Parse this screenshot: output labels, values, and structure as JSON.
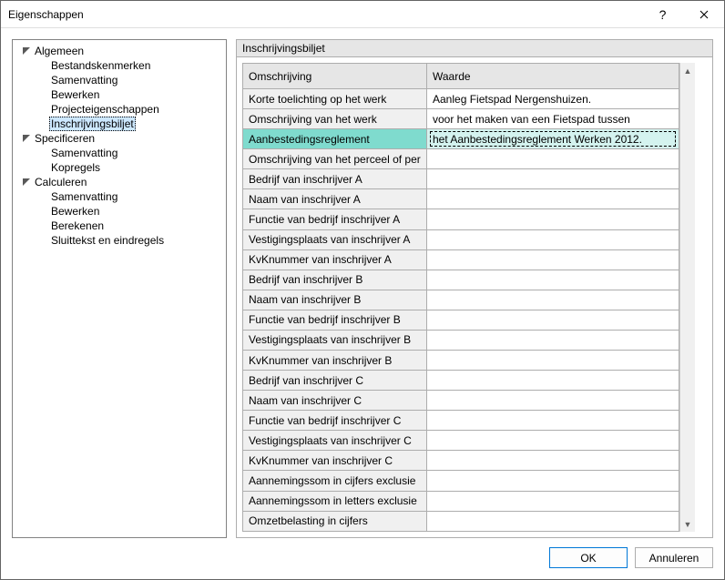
{
  "dialog": {
    "title": "Eigenschappen"
  },
  "buttons": {
    "ok": "OK",
    "cancel": "Annuleren"
  },
  "tree": {
    "groups": [
      {
        "label": "Algemeen",
        "items": [
          {
            "label": "Bestandskenmerken"
          },
          {
            "label": "Samenvatting"
          },
          {
            "label": "Bewerken"
          },
          {
            "label": "Projecteigenschappen"
          },
          {
            "label": "Inschrijvingsbiljet",
            "selected": true
          }
        ]
      },
      {
        "label": "Specificeren",
        "items": [
          {
            "label": "Samenvatting"
          },
          {
            "label": "Kopregels"
          }
        ]
      },
      {
        "label": "Calculeren",
        "items": [
          {
            "label": "Samenvatting"
          },
          {
            "label": "Bewerken"
          },
          {
            "label": "Berekenen"
          },
          {
            "label": "Sluittekst en eindregels"
          }
        ]
      }
    ]
  },
  "panel": {
    "title": "Inschrijvingsbiljet",
    "columns": {
      "desc": "Omschrijving",
      "val": "Waarde"
    },
    "rows": [
      {
        "desc": "Korte toelichting op het werk",
        "val": "Aanleg Fietspad Nergenshuizen."
      },
      {
        "desc": "Omschrijving van het werk",
        "val": "voor het maken van een Fietspad tussen"
      },
      {
        "desc": "Aanbestedingsreglement",
        "val": "het Aanbestedingsreglement Werken 2012.",
        "selected": true
      },
      {
        "desc": "Omschrijving van het perceel of per",
        "val": ""
      },
      {
        "desc": "Bedrijf van inschrijver A",
        "val": ""
      },
      {
        "desc": "Naam van inschrijver A",
        "val": ""
      },
      {
        "desc": "Functie van bedrijf inschrijver A",
        "val": ""
      },
      {
        "desc": "Vestigingsplaats van inschrijver A",
        "val": ""
      },
      {
        "desc": "KvKnummer van inschrijver A",
        "val": ""
      },
      {
        "desc": "Bedrijf van inschrijver B",
        "val": ""
      },
      {
        "desc": "Naam van inschrijver B",
        "val": ""
      },
      {
        "desc": "Functie van bedrijf inschrijver B",
        "val": ""
      },
      {
        "desc": "Vestigingsplaats van inschrijver B",
        "val": ""
      },
      {
        "desc": "KvKnummer van inschrijver B",
        "val": ""
      },
      {
        "desc": "Bedrijf van inschrijver C",
        "val": ""
      },
      {
        "desc": "Naam van inschrijver C",
        "val": ""
      },
      {
        "desc": "Functie van bedrijf inschrijver C",
        "val": ""
      },
      {
        "desc": "Vestigingsplaats van inschrijver C",
        "val": ""
      },
      {
        "desc": "KvKnummer van inschrijver C",
        "val": ""
      },
      {
        "desc": "Aannemingssom in cijfers exclusie",
        "val": ""
      },
      {
        "desc": "Aannemingssom in letters exclusie",
        "val": ""
      },
      {
        "desc": "Omzetbelasting in cijfers",
        "val": ""
      }
    ]
  }
}
